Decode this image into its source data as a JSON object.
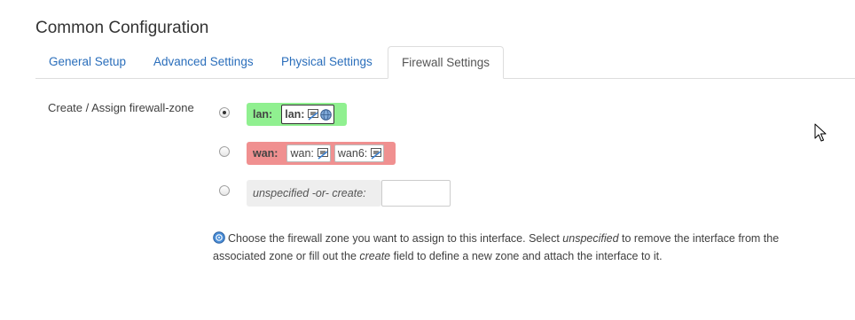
{
  "section": {
    "title": "Common Configuration"
  },
  "tabs": [
    {
      "label": "General Setup",
      "active": false
    },
    {
      "label": "Advanced Settings",
      "active": false
    },
    {
      "label": "Physical Settings",
      "active": false
    },
    {
      "label": "Firewall Settings",
      "active": true
    }
  ],
  "firewall": {
    "label": "Create / Assign firewall-zone",
    "zones": [
      {
        "name": "lan:",
        "selected": true,
        "color": "#90f090",
        "interfaces": [
          {
            "label": "lan:",
            "icons": [
              "ethernet-port-icon",
              "wireless-icon"
            ]
          }
        ]
      },
      {
        "name": "wan:",
        "selected": false,
        "color": "#f09090",
        "interfaces": [
          {
            "label": "wan:",
            "icons": [
              "ethernet-port-icon"
            ]
          },
          {
            "label": "wan6:",
            "icons": [
              "ethernet-port-icon"
            ]
          }
        ]
      }
    ],
    "unspecified": {
      "label": "unspecified -or- create:",
      "selected": false,
      "create_value": ""
    },
    "help": {
      "part1": "Choose the firewall zone you want to assign to this interface. Select ",
      "em1": "unspecified",
      "part2": " to remove the interface from the associated zone or fill out the ",
      "em2": "create",
      "part3": " field to define a new zone and attach the interface to it."
    }
  },
  "colors": {
    "link": "#2a6ebb",
    "lan_zone": "#90f090",
    "wan_zone": "#f09090",
    "unspecified_zone": "#eeeeee"
  }
}
